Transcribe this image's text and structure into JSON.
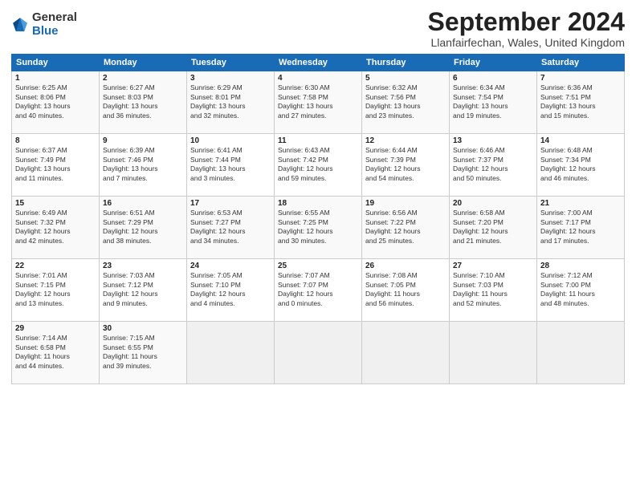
{
  "logo": {
    "general": "General",
    "blue": "Blue"
  },
  "title": "September 2024",
  "location": "Llanfairfechan, Wales, United Kingdom",
  "headers": [
    "Sunday",
    "Monday",
    "Tuesday",
    "Wednesday",
    "Thursday",
    "Friday",
    "Saturday"
  ],
  "weeks": [
    [
      {
        "day": "1",
        "info": "Sunrise: 6:25 AM\nSunset: 8:06 PM\nDaylight: 13 hours\nand 40 minutes."
      },
      {
        "day": "2",
        "info": "Sunrise: 6:27 AM\nSunset: 8:03 PM\nDaylight: 13 hours\nand 36 minutes."
      },
      {
        "day": "3",
        "info": "Sunrise: 6:29 AM\nSunset: 8:01 PM\nDaylight: 13 hours\nand 32 minutes."
      },
      {
        "day": "4",
        "info": "Sunrise: 6:30 AM\nSunset: 7:58 PM\nDaylight: 13 hours\nand 27 minutes."
      },
      {
        "day": "5",
        "info": "Sunrise: 6:32 AM\nSunset: 7:56 PM\nDaylight: 13 hours\nand 23 minutes."
      },
      {
        "day": "6",
        "info": "Sunrise: 6:34 AM\nSunset: 7:54 PM\nDaylight: 13 hours\nand 19 minutes."
      },
      {
        "day": "7",
        "info": "Sunrise: 6:36 AM\nSunset: 7:51 PM\nDaylight: 13 hours\nand 15 minutes."
      }
    ],
    [
      {
        "day": "8",
        "info": "Sunrise: 6:37 AM\nSunset: 7:49 PM\nDaylight: 13 hours\nand 11 minutes."
      },
      {
        "day": "9",
        "info": "Sunrise: 6:39 AM\nSunset: 7:46 PM\nDaylight: 13 hours\nand 7 minutes."
      },
      {
        "day": "10",
        "info": "Sunrise: 6:41 AM\nSunset: 7:44 PM\nDaylight: 13 hours\nand 3 minutes."
      },
      {
        "day": "11",
        "info": "Sunrise: 6:43 AM\nSunset: 7:42 PM\nDaylight: 12 hours\nand 59 minutes."
      },
      {
        "day": "12",
        "info": "Sunrise: 6:44 AM\nSunset: 7:39 PM\nDaylight: 12 hours\nand 54 minutes."
      },
      {
        "day": "13",
        "info": "Sunrise: 6:46 AM\nSunset: 7:37 PM\nDaylight: 12 hours\nand 50 minutes."
      },
      {
        "day": "14",
        "info": "Sunrise: 6:48 AM\nSunset: 7:34 PM\nDaylight: 12 hours\nand 46 minutes."
      }
    ],
    [
      {
        "day": "15",
        "info": "Sunrise: 6:49 AM\nSunset: 7:32 PM\nDaylight: 12 hours\nand 42 minutes."
      },
      {
        "day": "16",
        "info": "Sunrise: 6:51 AM\nSunset: 7:29 PM\nDaylight: 12 hours\nand 38 minutes."
      },
      {
        "day": "17",
        "info": "Sunrise: 6:53 AM\nSunset: 7:27 PM\nDaylight: 12 hours\nand 34 minutes."
      },
      {
        "day": "18",
        "info": "Sunrise: 6:55 AM\nSunset: 7:25 PM\nDaylight: 12 hours\nand 30 minutes."
      },
      {
        "day": "19",
        "info": "Sunrise: 6:56 AM\nSunset: 7:22 PM\nDaylight: 12 hours\nand 25 minutes."
      },
      {
        "day": "20",
        "info": "Sunrise: 6:58 AM\nSunset: 7:20 PM\nDaylight: 12 hours\nand 21 minutes."
      },
      {
        "day": "21",
        "info": "Sunrise: 7:00 AM\nSunset: 7:17 PM\nDaylight: 12 hours\nand 17 minutes."
      }
    ],
    [
      {
        "day": "22",
        "info": "Sunrise: 7:01 AM\nSunset: 7:15 PM\nDaylight: 12 hours\nand 13 minutes."
      },
      {
        "day": "23",
        "info": "Sunrise: 7:03 AM\nSunset: 7:12 PM\nDaylight: 12 hours\nand 9 minutes."
      },
      {
        "day": "24",
        "info": "Sunrise: 7:05 AM\nSunset: 7:10 PM\nDaylight: 12 hours\nand 4 minutes."
      },
      {
        "day": "25",
        "info": "Sunrise: 7:07 AM\nSunset: 7:07 PM\nDaylight: 12 hours\nand 0 minutes."
      },
      {
        "day": "26",
        "info": "Sunrise: 7:08 AM\nSunset: 7:05 PM\nDaylight: 11 hours\nand 56 minutes."
      },
      {
        "day": "27",
        "info": "Sunrise: 7:10 AM\nSunset: 7:03 PM\nDaylight: 11 hours\nand 52 minutes."
      },
      {
        "day": "28",
        "info": "Sunrise: 7:12 AM\nSunset: 7:00 PM\nDaylight: 11 hours\nand 48 minutes."
      }
    ],
    [
      {
        "day": "29",
        "info": "Sunrise: 7:14 AM\nSunset: 6:58 PM\nDaylight: 11 hours\nand 44 minutes."
      },
      {
        "day": "30",
        "info": "Sunrise: 7:15 AM\nSunset: 6:55 PM\nDaylight: 11 hours\nand 39 minutes."
      },
      null,
      null,
      null,
      null,
      null
    ]
  ]
}
